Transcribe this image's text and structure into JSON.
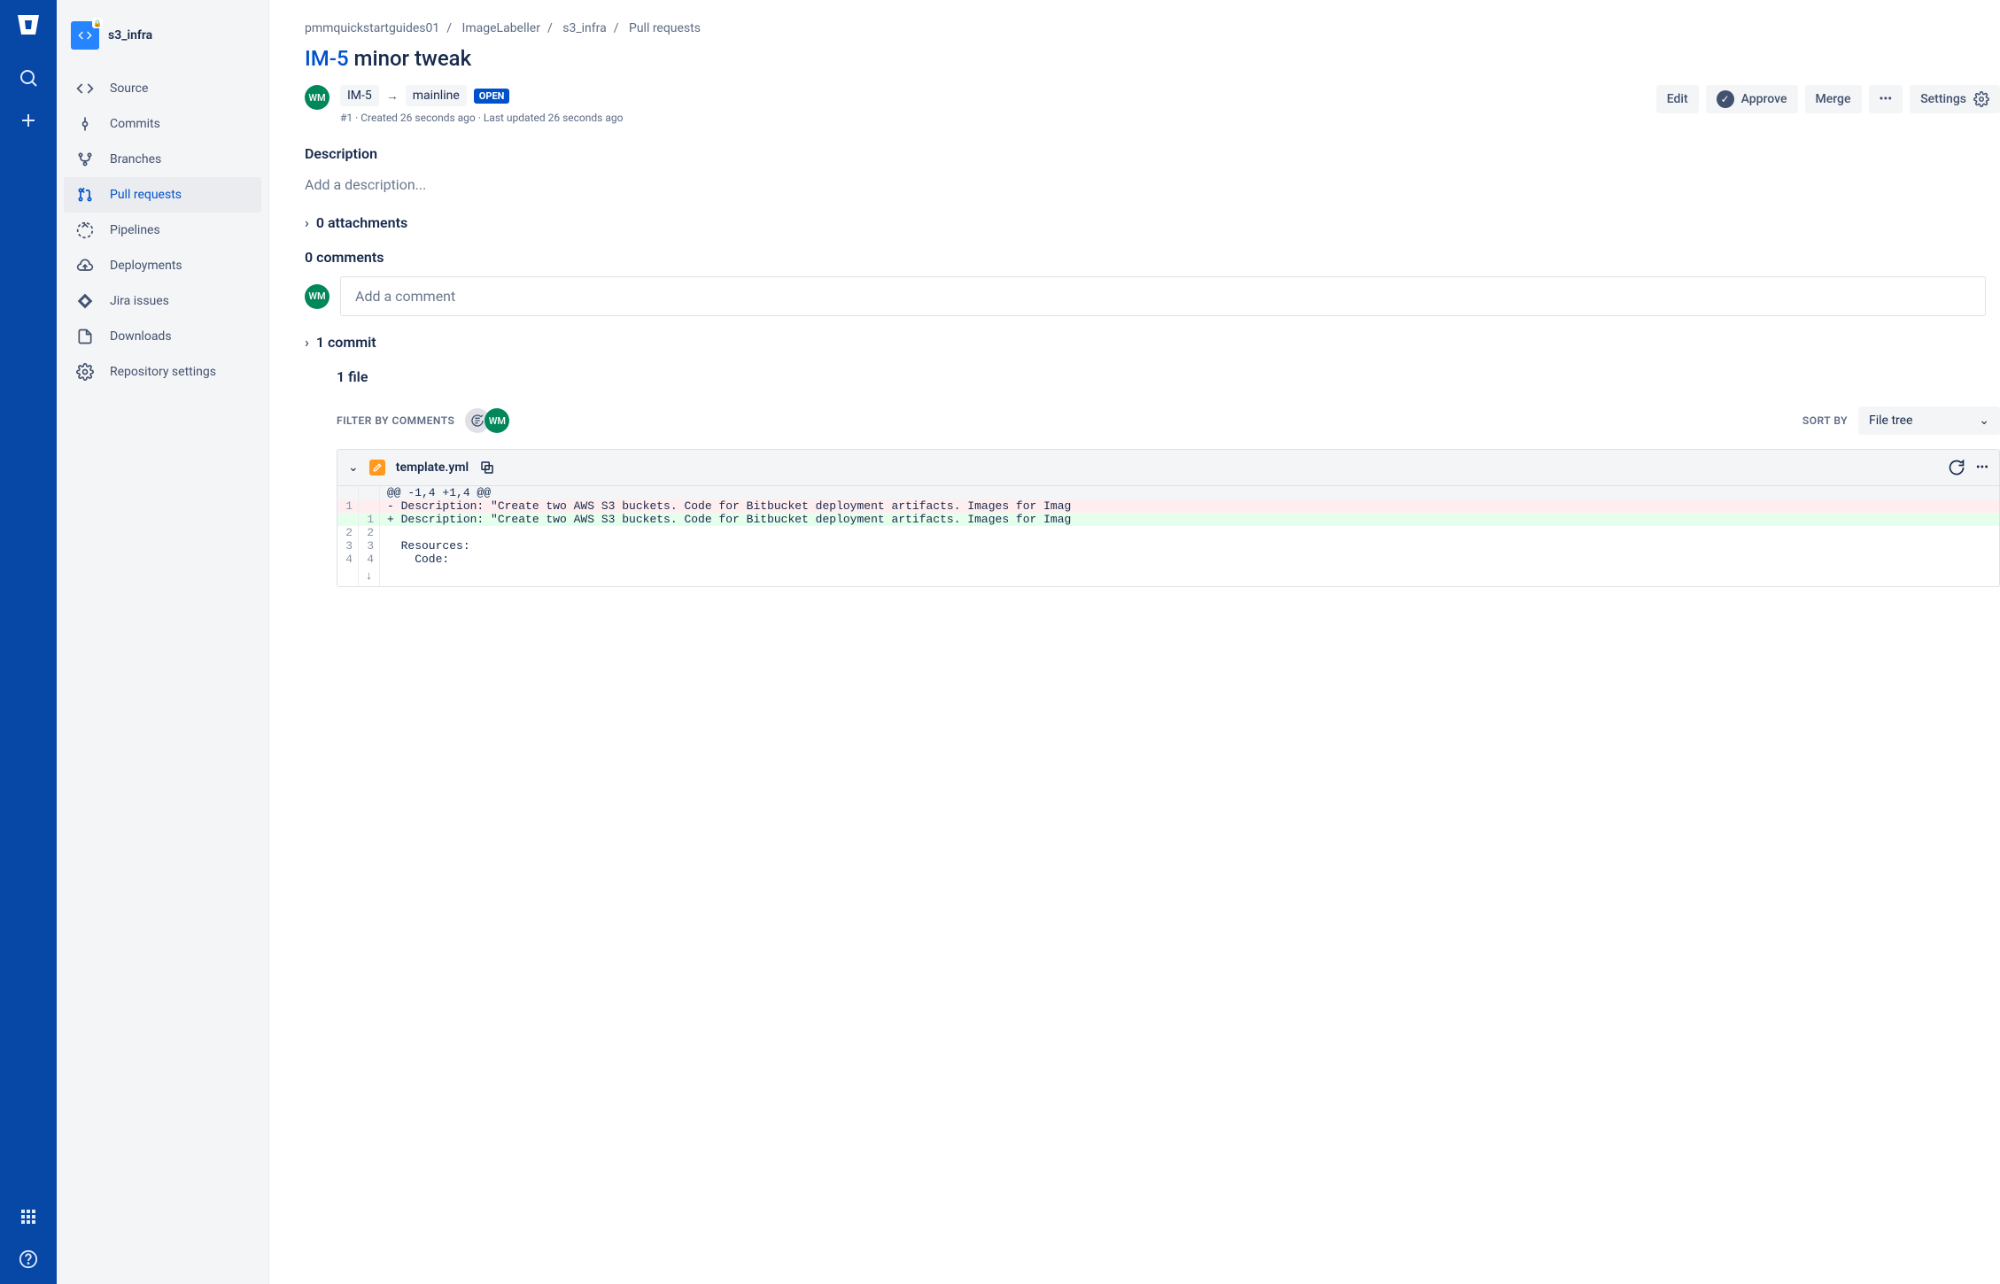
{
  "repo": {
    "name": "s3_infra",
    "avatar_initials": "</>"
  },
  "sidebar": {
    "items": [
      {
        "label": "Source"
      },
      {
        "label": "Commits"
      },
      {
        "label": "Branches"
      },
      {
        "label": "Pull requests"
      },
      {
        "label": "Pipelines"
      },
      {
        "label": "Deployments"
      },
      {
        "label": "Jira issues"
      },
      {
        "label": "Downloads"
      },
      {
        "label": "Repository settings"
      }
    ]
  },
  "breadcrumbs": [
    "pmmquickstartguides01",
    "ImageLabeller",
    "s3_infra",
    "Pull requests"
  ],
  "pr": {
    "issue_key": "IM-5",
    "title_rest": " minor tweak",
    "source_branch": "IM-5",
    "target_branch": "mainline",
    "status": "OPEN",
    "number_text": "#1",
    "created_text": "Created 26 seconds ago",
    "updated_text": "Last updated 26 seconds ago",
    "author_initials": "WM"
  },
  "actions": {
    "edit": "Edit",
    "approve": "Approve",
    "merge": "Merge",
    "settings": "Settings"
  },
  "sections": {
    "description_heading": "Description",
    "description_placeholder": "Add a description...",
    "attachments": "0 attachments",
    "comments_heading": "0 comments",
    "comment_placeholder": "Add a comment",
    "commits": "1 commit",
    "files": "1 file"
  },
  "filters": {
    "filter_label": "FILTER BY COMMENTS",
    "sort_label": "SORT BY",
    "sort_value": "File tree",
    "commenter_initials": "WM"
  },
  "diff": {
    "filename": "template.yml",
    "hunk": "@@ -1,4 +1,4 @@",
    "lines": [
      {
        "old": "1",
        "new": "",
        "type": "del",
        "text": "- Description: \"Create two AWS S3 buckets. Code for Bitbucket deployment artifacts. Images for Imag"
      },
      {
        "old": "",
        "new": "1",
        "type": "add",
        "text": "+ Description: \"Create two AWS S3 buckets. Code for Bitbucket deployment artifacts. Images for Imag"
      },
      {
        "old": "2",
        "new": "2",
        "type": "ctx",
        "text": "  "
      },
      {
        "old": "3",
        "new": "3",
        "type": "ctx",
        "text": "  Resources:"
      },
      {
        "old": "4",
        "new": "4",
        "type": "ctx",
        "text": "    Code:"
      }
    ]
  }
}
